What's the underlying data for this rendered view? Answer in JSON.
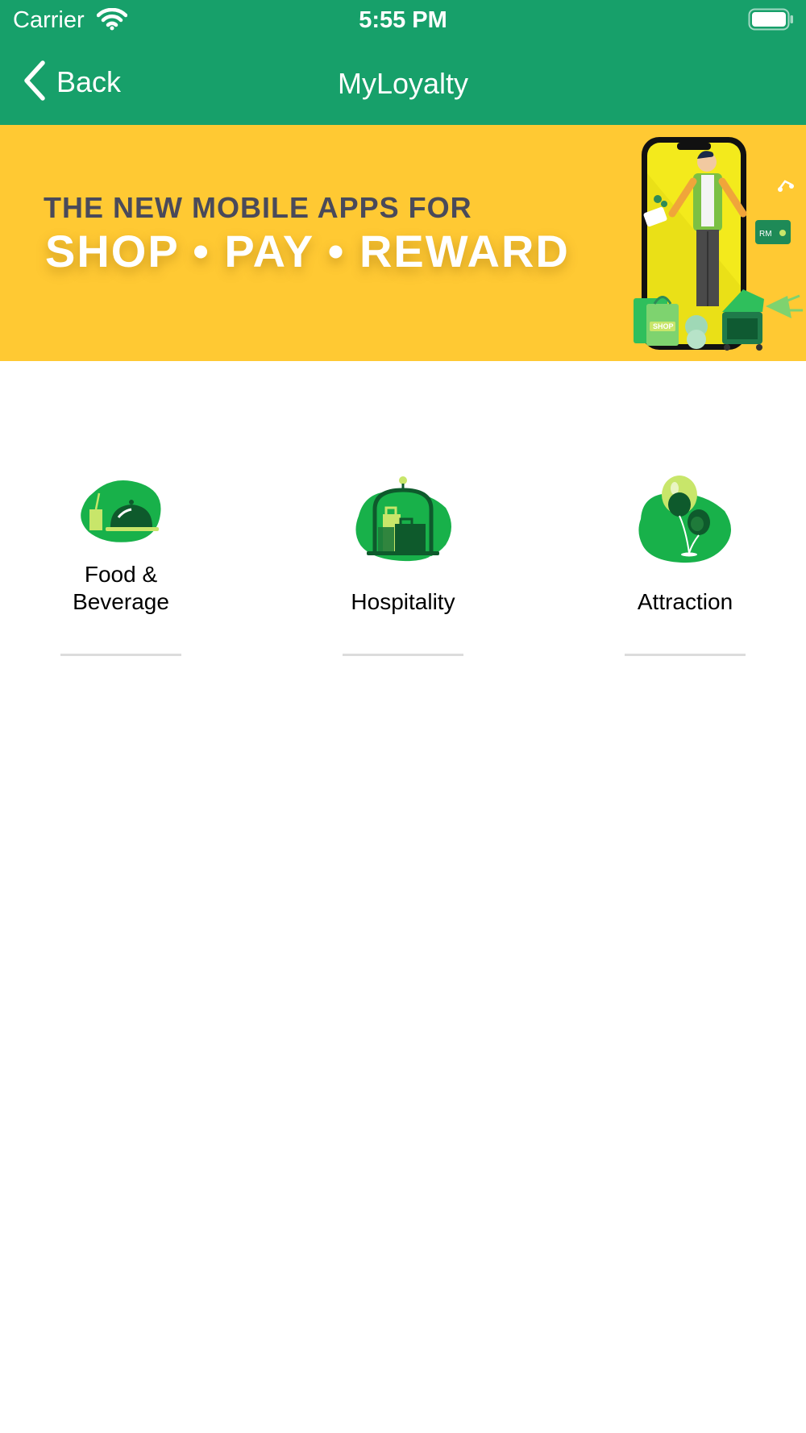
{
  "status_bar": {
    "carrier": "Carrier",
    "time": "5:55 PM"
  },
  "nav": {
    "back_label": "Back",
    "title": "MyLoyalty"
  },
  "banner": {
    "line1": "THE NEW MOBILE APPS FOR",
    "line2": "SHOP • PAY • REWARD",
    "bag_text": "SHOP",
    "wallet_text": "RM"
  },
  "categories": [
    {
      "label": "Food &\nBeverage",
      "icon": "food-cloche-icon"
    },
    {
      "label": "Hospitality",
      "icon": "luggage-cart-icon"
    },
    {
      "label": "Attraction",
      "icon": "balloons-icon"
    }
  ],
  "colors": {
    "primary": "#17a06a",
    "banner": "#ffc933",
    "icon_green": "#18b14a"
  }
}
